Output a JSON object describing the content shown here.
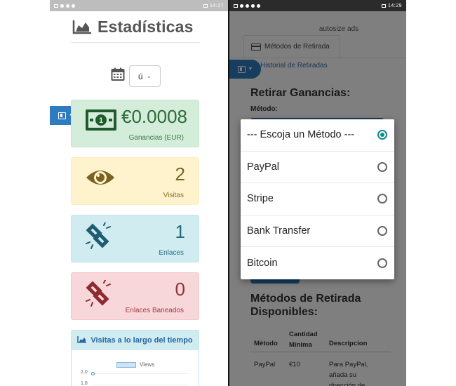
{
  "left_phone": {
    "status_time": "14:27",
    "title": "Estadísticas",
    "date_select_value": "ú",
    "cards": [
      {
        "value": "€0.0008",
        "label": "Ganancias (EUR)",
        "icon": "money-bill-icon"
      },
      {
        "value": "2",
        "label": "Visitas",
        "icon": "eye-icon"
      },
      {
        "value": "1",
        "label": "Enlaces",
        "icon": "link-icon"
      },
      {
        "value": "0",
        "label": "Enlaces Baneados",
        "icon": "broken-link-icon"
      }
    ],
    "chart_title": "Visitas a lo largo del tiempo",
    "chart_data": {
      "type": "line",
      "title": "Visitas a lo largo del tiempo",
      "series": [
        {
          "name": "Views",
          "values": [
            2.0
          ]
        }
      ],
      "yticks": [
        "2,0",
        "1,8"
      ]
    }
  },
  "right_phone": {
    "status_time": "14:29",
    "ad_text": "autosize ads",
    "tabs": {
      "active": "Métodos de Retirada",
      "link": "Historial de Retiradas"
    },
    "heading_withdraw": "Retirar Ganancias:",
    "method_label": "Método:",
    "heading_methods": "Métodos de Retirada Disponibles:",
    "table": {
      "headers": [
        "Método",
        "Cantidad Mínima",
        "Descripcion"
      ],
      "rows": [
        {
          "method": "PayPal",
          "min": "€10",
          "desc": "Para PayPal, añada su dirección de"
        }
      ]
    },
    "dialog": {
      "options": [
        {
          "label": "--- Escoja un Método ---",
          "selected": true
        },
        {
          "label": "PayPal",
          "selected": false
        },
        {
          "label": "Stripe",
          "selected": false
        },
        {
          "label": "Bank Transfer",
          "selected": false
        },
        {
          "label": "Bitcoin",
          "selected": false
        }
      ]
    }
  }
}
